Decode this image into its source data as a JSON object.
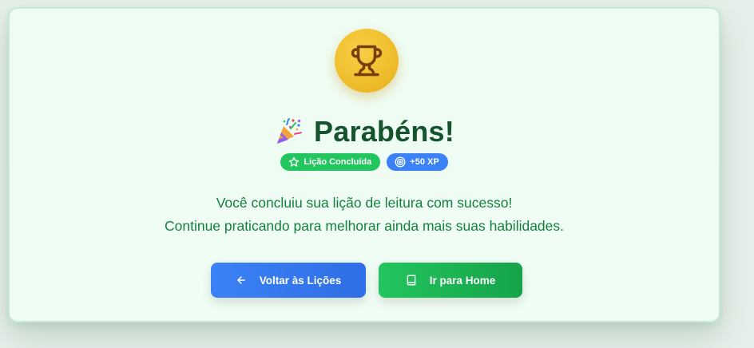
{
  "card": {
    "title": "Parabéns!",
    "badges": {
      "completed": "Lição Concluída",
      "xp": "+50 XP"
    },
    "message_line1": "Você concluiu sua lição de leitura com sucesso!",
    "message_line2": "Continue praticando para melhorar ainda mais suas habilidades.",
    "buttons": {
      "back": "Voltar às Lições",
      "home": "Ir para Home"
    }
  },
  "icons": {
    "trophy": "trophy-icon",
    "party": "party-popper-icon",
    "star": "star-icon",
    "target": "target-icon",
    "arrow_left": "arrow-left-icon",
    "book": "book-icon"
  },
  "colors": {
    "title": "#14532d",
    "message": "#15803d",
    "trophy": "#f0bf2e",
    "badge_green": "#22c55e",
    "badge_blue": "#3b82f6",
    "button_blue": "#3b82f6",
    "button_green": "#16a34a"
  }
}
